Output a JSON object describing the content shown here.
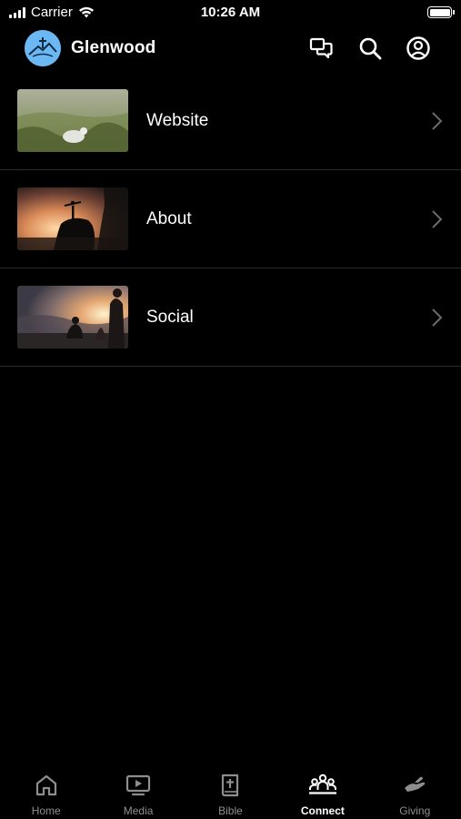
{
  "status_bar": {
    "carrier": "Carrier",
    "time": "10:26 AM"
  },
  "header": {
    "title": "Glenwood",
    "icons": [
      "chat-icon",
      "search-icon",
      "profile-icon"
    ]
  },
  "list": {
    "items": [
      {
        "label": "Website",
        "thumbnail": "grass-field-thumbnail"
      },
      {
        "label": "About",
        "thumbnail": "sunset-rock-thumbnail"
      },
      {
        "label": "Social",
        "thumbnail": "sunset-people-thumbnail"
      }
    ]
  },
  "tab_bar": {
    "tabs": [
      {
        "label": "Home",
        "icon": "home-icon",
        "active": false
      },
      {
        "label": "Media",
        "icon": "media-icon",
        "active": false
      },
      {
        "label": "Bible",
        "icon": "bible-icon",
        "active": false
      },
      {
        "label": "Connect",
        "icon": "connect-icon",
        "active": true
      },
      {
        "label": "Giving",
        "icon": "giving-icon",
        "active": false
      }
    ]
  },
  "colors": {
    "background": "#000000",
    "logo_blue": "#6cb8f5",
    "inactive_tab": "#8e8e8e",
    "divider": "#2a2a2a"
  }
}
